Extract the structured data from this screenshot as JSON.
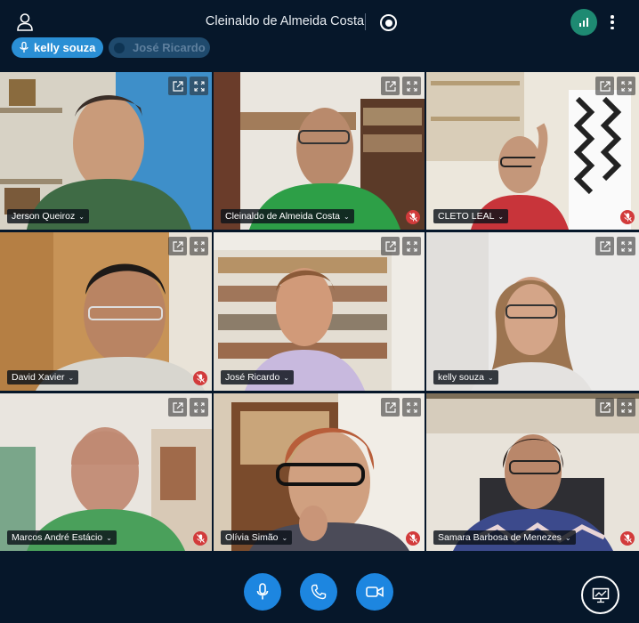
{
  "header": {
    "title": "Cleinaldo de Almeida Costa",
    "icons": {
      "user": "user-icon",
      "record": "record-icon",
      "stats": "connection-stats-icon",
      "more": "more-options-icon"
    },
    "colors": {
      "stats_bg": "#1e8a72"
    }
  },
  "talking_indicators": [
    {
      "name": "kelly souza",
      "talking": true
    },
    {
      "name": "José Ricardo",
      "talking": false
    }
  ],
  "participants": [
    {
      "name": "Jerson Queiroz",
      "muted": false,
      "active": false
    },
    {
      "name": "Cleinaldo de Almeida Costa",
      "muted": true,
      "active": false
    },
    {
      "name": "CLETO LEAL",
      "muted": true,
      "active": false
    },
    {
      "name": "David Xavier",
      "muted": true,
      "active": false
    },
    {
      "name": "José Ricardo",
      "muted": false,
      "active": false
    },
    {
      "name": "kelly souza",
      "muted": false,
      "active": true
    },
    {
      "name": "Marcos André Estácio",
      "muted": true,
      "active": false
    },
    {
      "name": "Olívia Simão",
      "muted": true,
      "active": false
    },
    {
      "name": "Samara Barbosa de Menezes",
      "muted": true,
      "active": false
    }
  ],
  "tile_icons": {
    "popout": "popout-icon",
    "fullscreen": "fullscreen-icon",
    "muted": "mic-muted-icon"
  },
  "controls": {
    "icons": [
      "microphone-icon",
      "phone-icon",
      "camera-icon",
      "presentation-icon"
    ],
    "accent": "#1d86e0"
  }
}
